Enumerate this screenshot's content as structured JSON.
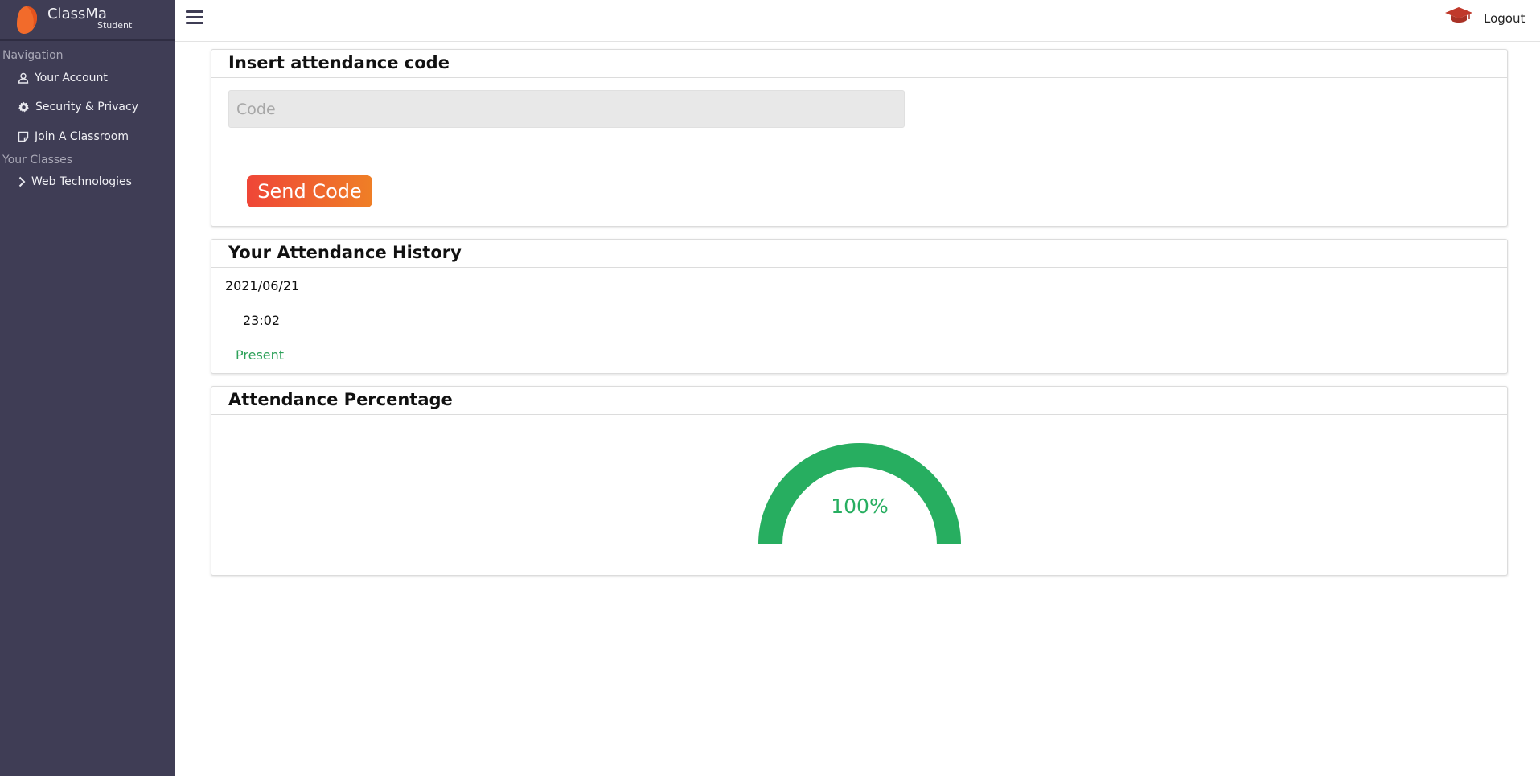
{
  "app": {
    "name": "ClassMa",
    "role": "Student",
    "brand_color": "#f26b2b"
  },
  "sidebar": {
    "navigation_label": "Navigation",
    "items": [
      {
        "label": "Your Account",
        "icon": "user-icon"
      },
      {
        "label": "Security & Privacy",
        "icon": "gear-icon"
      },
      {
        "label": "Join A Classroom",
        "icon": "note-icon"
      }
    ],
    "classes_label": "Your Classes",
    "classes": [
      {
        "label": "Web Technologies",
        "icon": "chevron-right-icon"
      }
    ]
  },
  "topbar": {
    "menu_icon": "hamburger-icon",
    "user_icon": "graduation-cap-icon",
    "logout_label": "Logout"
  },
  "code_card": {
    "title": "Insert attendance code",
    "input_placeholder": "Code",
    "input_value": "",
    "send_label": "Send Code"
  },
  "history_card": {
    "title": "Your Attendance History",
    "entries": [
      {
        "date": "2021/06/21",
        "time": "23:02",
        "status": "Present"
      }
    ]
  },
  "percent_card": {
    "title": "Attendance Percentage",
    "value": 100,
    "label": "100%",
    "color": "#27ae60"
  }
}
